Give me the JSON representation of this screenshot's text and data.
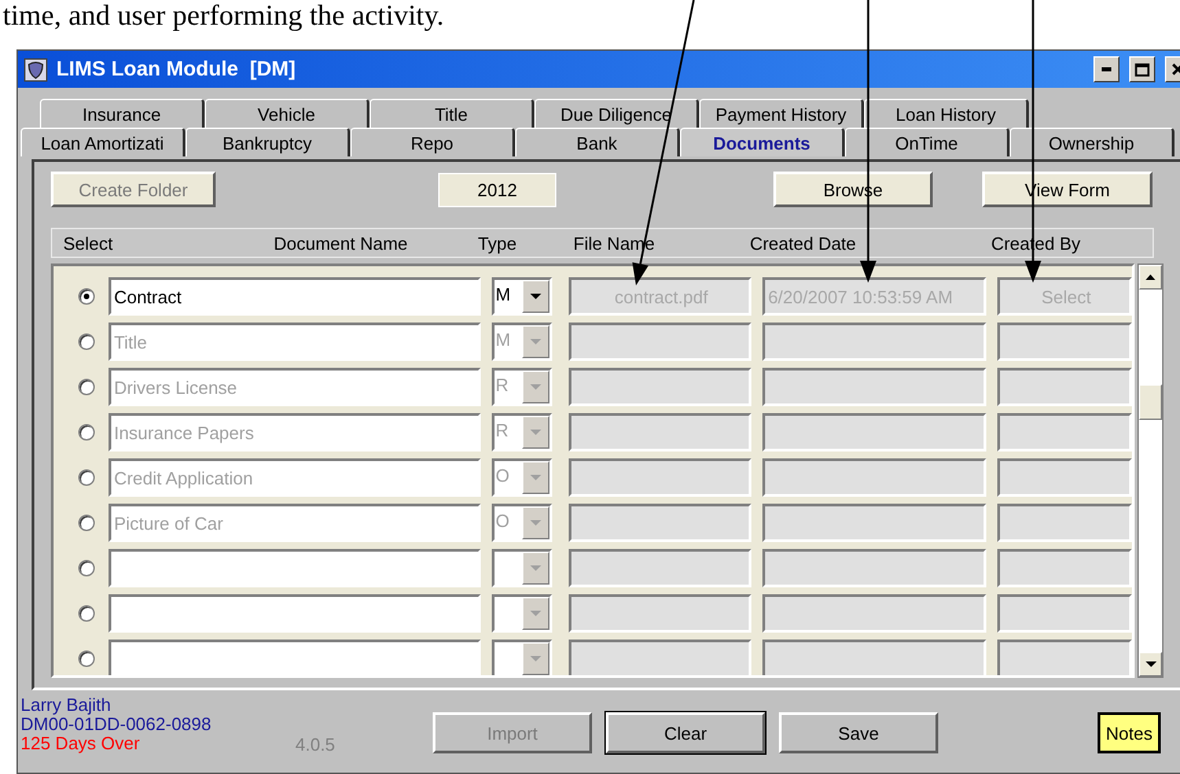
{
  "caption": "time, and user performing the activity.",
  "window": {
    "title": "LIMS Loan Module  [DM]"
  },
  "tab_rows": [
    [
      {
        "label": "Insurance",
        "selected": false
      },
      {
        "label": "Vehicle",
        "selected": false
      },
      {
        "label": "Title",
        "selected": false
      },
      {
        "label": "Due Diligence",
        "selected": false
      },
      {
        "label": "Payment History",
        "selected": false
      },
      {
        "label": "Loan History",
        "selected": false
      }
    ],
    [
      {
        "label": "Loan Amortizati",
        "selected": false
      },
      {
        "label": "Bankruptcy",
        "selected": false
      },
      {
        "label": "Repo",
        "selected": false
      },
      {
        "label": "Bank",
        "selected": false
      },
      {
        "label": "Documents",
        "selected": true
      },
      {
        "label": "OnTime",
        "selected": false
      },
      {
        "label": "Ownership",
        "selected": false
      }
    ]
  ],
  "toolbar": {
    "create_folder": {
      "label": "Create Folder",
      "disabled": true
    },
    "year": "2012",
    "browse": {
      "label": "Browse",
      "disabled": false
    },
    "view_form": {
      "label": "View Form",
      "disabled": false
    }
  },
  "columns": [
    "Select",
    "Document Name",
    "Type",
    "File Name",
    "Created Date",
    "Created By"
  ],
  "rows": [
    {
      "selected": true,
      "disabled": false,
      "name": "Contract",
      "type": "M",
      "file_name": "contract.pdf",
      "created_date": "6/20/2007 10:53:59 AM",
      "created_by": "Select"
    },
    {
      "selected": false,
      "disabled": true,
      "name": "Title",
      "type": "M"
    },
    {
      "selected": false,
      "disabled": true,
      "name": "Drivers License",
      "type": "R"
    },
    {
      "selected": false,
      "disabled": true,
      "name": "Insurance Papers",
      "type": "R"
    },
    {
      "selected": false,
      "disabled": true,
      "name": "Credit Application",
      "type": "O"
    },
    {
      "selected": false,
      "disabled": true,
      "name": "Picture of Car",
      "type": "O"
    },
    {
      "selected": false
    },
    {
      "selected": false
    },
    {
      "selected": false
    }
  ],
  "status": {
    "customer": "Larry  Bajith",
    "account": "DM00-01DD-0062-0898",
    "overdue": "125 Days Over",
    "version": "4.0.5"
  },
  "buttons": [
    {
      "label": "Import",
      "disabled": true,
      "focused": false
    },
    {
      "label": "Clear",
      "disabled": false,
      "focused": true
    },
    {
      "label": "Save",
      "disabled": false,
      "focused": false
    }
  ],
  "notes_button": {
    "label": "Notes"
  }
}
